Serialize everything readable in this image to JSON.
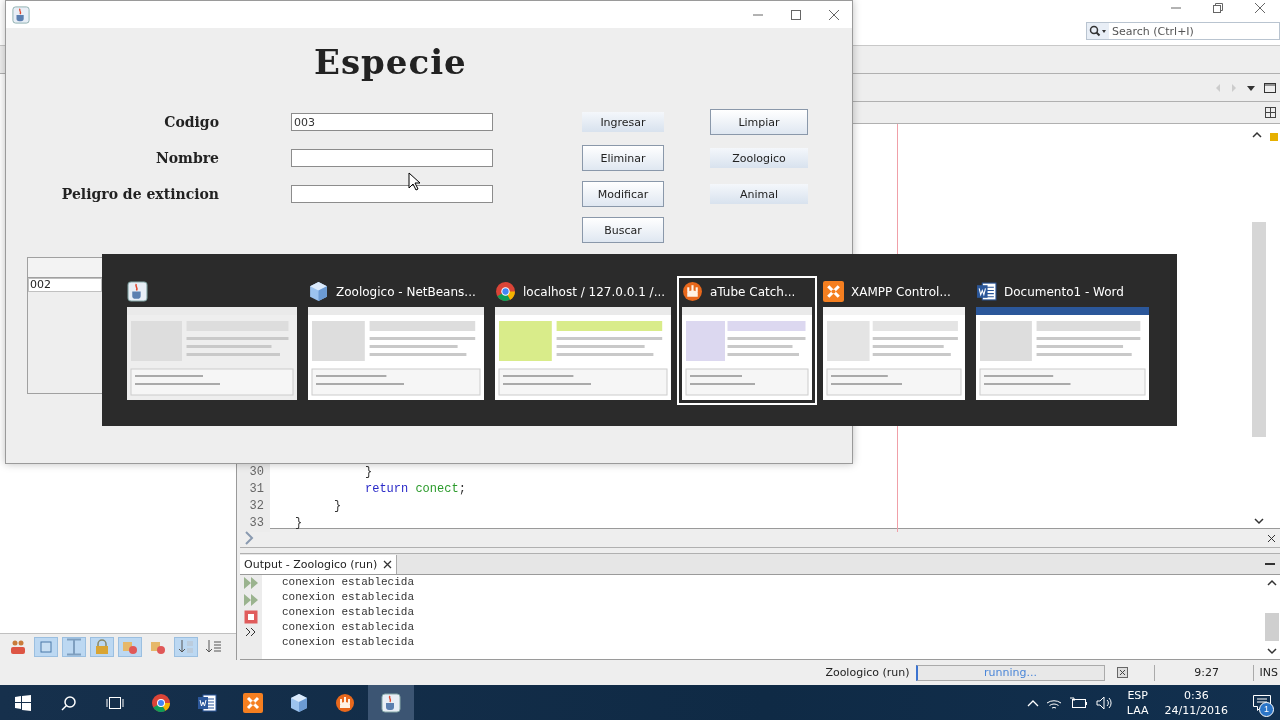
{
  "ide": {
    "search": {
      "placeholder": "Search (Ctrl+I)"
    },
    "editor": {
      "lines": [
        {
          "number": "30",
          "tokens": [
            {
              "text": "}",
              "kind": "plain"
            }
          ]
        },
        {
          "number": "31",
          "tokens": [
            {
              "text": "return ",
              "kind": "keyword"
            },
            {
              "text": "conect",
              "kind": "field"
            },
            {
              "text": ";",
              "kind": "plain"
            }
          ]
        },
        {
          "number": "32",
          "tokens": [
            {
              "text": "}",
              "kind": "plain"
            }
          ]
        },
        {
          "number": "33",
          "tokens": [
            {
              "text": "}",
              "kind": "plain"
            }
          ]
        }
      ]
    },
    "output": {
      "tab": "Output - Zoologico (run)",
      "lines": [
        "conexion establecida",
        "conexion establecida",
        "conexion establecida",
        "conexion establecida",
        "conexion establecida"
      ]
    },
    "navigator_tools": [
      {
        "kind": "people",
        "on": false
      },
      {
        "kind": "square",
        "on": true
      },
      {
        "kind": "bar",
        "on": true
      },
      {
        "kind": "lock",
        "on": true
      },
      {
        "kind": "shapes",
        "on": true
      },
      {
        "kind": "shapes",
        "on": false
      },
      {
        "kind": "sort",
        "on": true
      },
      {
        "kind": "list",
        "on": false
      }
    ],
    "status_bar": {
      "task": "Zoologico (run)",
      "progress": "running...",
      "position": "9:27",
      "mode": "INS"
    }
  },
  "form": {
    "title": "Especie",
    "fields": [
      {
        "label": "Codigo",
        "value": "003"
      },
      {
        "label": "Nombre"
      },
      {
        "label": "Peligro de extincion"
      }
    ],
    "actions": [
      {
        "label": "Ingresar",
        "kind": "flat"
      },
      {
        "label": "Eliminar",
        "kind": "raised"
      },
      {
        "label": "Modificar",
        "kind": "raised"
      },
      {
        "label": "Buscar",
        "kind": "raised"
      }
    ],
    "nav_buttons": [
      {
        "label": "Limpiar",
        "kind": "raised"
      },
      {
        "label": "Zoologico",
        "kind": "flat"
      },
      {
        "label": "Animal",
        "kind": "flat"
      }
    ],
    "table": {
      "first_cell": "002"
    }
  },
  "switcher": {
    "items": [
      {
        "kind": "java",
        "selected": false
      },
      {
        "kind": "netbeans",
        "title": "Zoologico - NetBeans...",
        "selected": false
      },
      {
        "kind": "chrome",
        "title": "localhost / 127.0.0.1 /...",
        "selected": false
      },
      {
        "kind": "atube",
        "title": "aTube Catch...",
        "selected": true
      },
      {
        "kind": "xampp",
        "title": "XAMPP Control...",
        "selected": false
      },
      {
        "kind": "word",
        "title": "Documento1 - Word",
        "selected": false
      }
    ]
  },
  "taskbar": {
    "apps": [
      {
        "kind": "chrome",
        "active": false
      },
      {
        "kind": "word",
        "active": false
      },
      {
        "kind": "xampp",
        "active": false
      },
      {
        "kind": "netbeans",
        "active": false
      },
      {
        "kind": "atube",
        "active": false
      },
      {
        "kind": "java",
        "active": true
      }
    ],
    "language": [
      "ESP",
      "LAA"
    ],
    "time": "0:36",
    "date": "24/11/2016",
    "notifications": "1"
  }
}
